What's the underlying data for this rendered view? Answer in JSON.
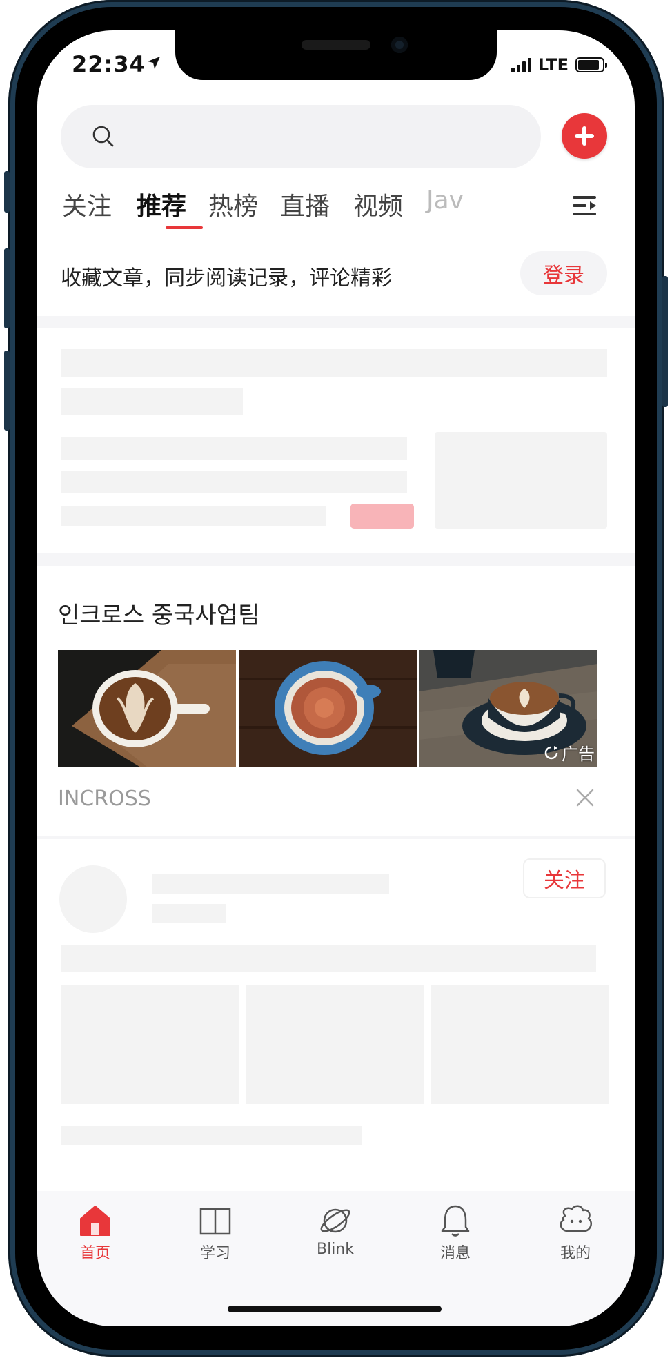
{
  "status_bar": {
    "time": "22:34",
    "network": "LTE"
  },
  "search": {
    "placeholder": ""
  },
  "tabs": [
    {
      "label": "关注",
      "active": false
    },
    {
      "label": "推荐",
      "active": true
    },
    {
      "label": "热榜",
      "active": false
    },
    {
      "label": "直播",
      "active": false
    },
    {
      "label": "视频",
      "active": false
    },
    {
      "label": "Jav",
      "active": false
    }
  ],
  "login_prompt": {
    "text": "收藏文章，同步阅读记录，评论精彩",
    "button_label": "登录"
  },
  "ad": {
    "title": "인크로스 중국사업팀",
    "label": "广告",
    "source": "INCROSS"
  },
  "feed": {
    "follow_label": "关注"
  },
  "bottom_nav": [
    {
      "label": "首页",
      "icon": "home-icon",
      "active": true
    },
    {
      "label": "学习",
      "icon": "book-icon",
      "active": false
    },
    {
      "label": "Blink",
      "icon": "planet-icon",
      "active": false
    },
    {
      "label": "消息",
      "icon": "bell-icon",
      "active": false
    },
    {
      "label": "我的",
      "icon": "profile-icon",
      "active": false
    }
  ],
  "colors": {
    "accent": "#e8373a",
    "skeleton": "#f3f3f3",
    "frame": "#1f3c52"
  }
}
